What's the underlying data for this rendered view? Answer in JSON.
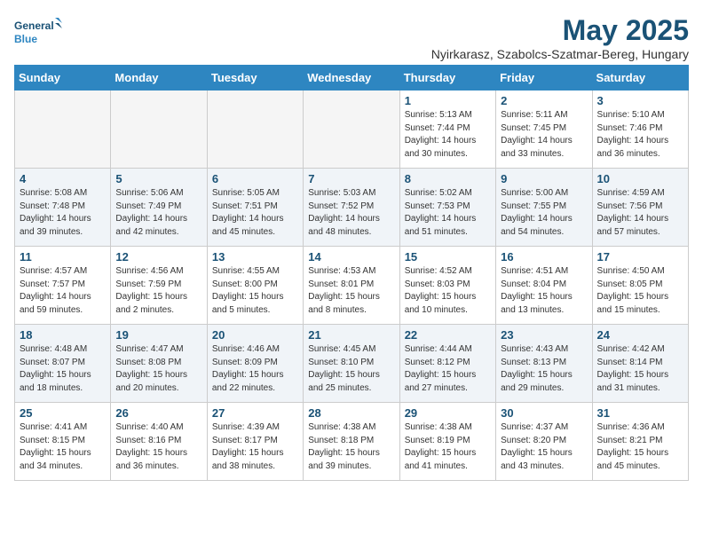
{
  "logo": {
    "line1": "General",
    "line2": "Blue"
  },
  "title": "May 2025",
  "location": "Nyirkarasz, Szabolcs-Szatmar-Bereg, Hungary",
  "weekdays": [
    "Sunday",
    "Monday",
    "Tuesday",
    "Wednesday",
    "Thursday",
    "Friday",
    "Saturday"
  ],
  "weeks": [
    [
      {
        "day": "",
        "info": ""
      },
      {
        "day": "",
        "info": ""
      },
      {
        "day": "",
        "info": ""
      },
      {
        "day": "",
        "info": ""
      },
      {
        "day": "1",
        "info": "Sunrise: 5:13 AM\nSunset: 7:44 PM\nDaylight: 14 hours\nand 30 minutes."
      },
      {
        "day": "2",
        "info": "Sunrise: 5:11 AM\nSunset: 7:45 PM\nDaylight: 14 hours\nand 33 minutes."
      },
      {
        "day": "3",
        "info": "Sunrise: 5:10 AM\nSunset: 7:46 PM\nDaylight: 14 hours\nand 36 minutes."
      }
    ],
    [
      {
        "day": "4",
        "info": "Sunrise: 5:08 AM\nSunset: 7:48 PM\nDaylight: 14 hours\nand 39 minutes."
      },
      {
        "day": "5",
        "info": "Sunrise: 5:06 AM\nSunset: 7:49 PM\nDaylight: 14 hours\nand 42 minutes."
      },
      {
        "day": "6",
        "info": "Sunrise: 5:05 AM\nSunset: 7:51 PM\nDaylight: 14 hours\nand 45 minutes."
      },
      {
        "day": "7",
        "info": "Sunrise: 5:03 AM\nSunset: 7:52 PM\nDaylight: 14 hours\nand 48 minutes."
      },
      {
        "day": "8",
        "info": "Sunrise: 5:02 AM\nSunset: 7:53 PM\nDaylight: 14 hours\nand 51 minutes."
      },
      {
        "day": "9",
        "info": "Sunrise: 5:00 AM\nSunset: 7:55 PM\nDaylight: 14 hours\nand 54 minutes."
      },
      {
        "day": "10",
        "info": "Sunrise: 4:59 AM\nSunset: 7:56 PM\nDaylight: 14 hours\nand 57 minutes."
      }
    ],
    [
      {
        "day": "11",
        "info": "Sunrise: 4:57 AM\nSunset: 7:57 PM\nDaylight: 14 hours\nand 59 minutes."
      },
      {
        "day": "12",
        "info": "Sunrise: 4:56 AM\nSunset: 7:59 PM\nDaylight: 15 hours\nand 2 minutes."
      },
      {
        "day": "13",
        "info": "Sunrise: 4:55 AM\nSunset: 8:00 PM\nDaylight: 15 hours\nand 5 minutes."
      },
      {
        "day": "14",
        "info": "Sunrise: 4:53 AM\nSunset: 8:01 PM\nDaylight: 15 hours\nand 8 minutes."
      },
      {
        "day": "15",
        "info": "Sunrise: 4:52 AM\nSunset: 8:03 PM\nDaylight: 15 hours\nand 10 minutes."
      },
      {
        "day": "16",
        "info": "Sunrise: 4:51 AM\nSunset: 8:04 PM\nDaylight: 15 hours\nand 13 minutes."
      },
      {
        "day": "17",
        "info": "Sunrise: 4:50 AM\nSunset: 8:05 PM\nDaylight: 15 hours\nand 15 minutes."
      }
    ],
    [
      {
        "day": "18",
        "info": "Sunrise: 4:48 AM\nSunset: 8:07 PM\nDaylight: 15 hours\nand 18 minutes."
      },
      {
        "day": "19",
        "info": "Sunrise: 4:47 AM\nSunset: 8:08 PM\nDaylight: 15 hours\nand 20 minutes."
      },
      {
        "day": "20",
        "info": "Sunrise: 4:46 AM\nSunset: 8:09 PM\nDaylight: 15 hours\nand 22 minutes."
      },
      {
        "day": "21",
        "info": "Sunrise: 4:45 AM\nSunset: 8:10 PM\nDaylight: 15 hours\nand 25 minutes."
      },
      {
        "day": "22",
        "info": "Sunrise: 4:44 AM\nSunset: 8:12 PM\nDaylight: 15 hours\nand 27 minutes."
      },
      {
        "day": "23",
        "info": "Sunrise: 4:43 AM\nSunset: 8:13 PM\nDaylight: 15 hours\nand 29 minutes."
      },
      {
        "day": "24",
        "info": "Sunrise: 4:42 AM\nSunset: 8:14 PM\nDaylight: 15 hours\nand 31 minutes."
      }
    ],
    [
      {
        "day": "25",
        "info": "Sunrise: 4:41 AM\nSunset: 8:15 PM\nDaylight: 15 hours\nand 34 minutes."
      },
      {
        "day": "26",
        "info": "Sunrise: 4:40 AM\nSunset: 8:16 PM\nDaylight: 15 hours\nand 36 minutes."
      },
      {
        "day": "27",
        "info": "Sunrise: 4:39 AM\nSunset: 8:17 PM\nDaylight: 15 hours\nand 38 minutes."
      },
      {
        "day": "28",
        "info": "Sunrise: 4:38 AM\nSunset: 8:18 PM\nDaylight: 15 hours\nand 39 minutes."
      },
      {
        "day": "29",
        "info": "Sunrise: 4:38 AM\nSunset: 8:19 PM\nDaylight: 15 hours\nand 41 minutes."
      },
      {
        "day": "30",
        "info": "Sunrise: 4:37 AM\nSunset: 8:20 PM\nDaylight: 15 hours\nand 43 minutes."
      },
      {
        "day": "31",
        "info": "Sunrise: 4:36 AM\nSunset: 8:21 PM\nDaylight: 15 hours\nand 45 minutes."
      }
    ]
  ]
}
